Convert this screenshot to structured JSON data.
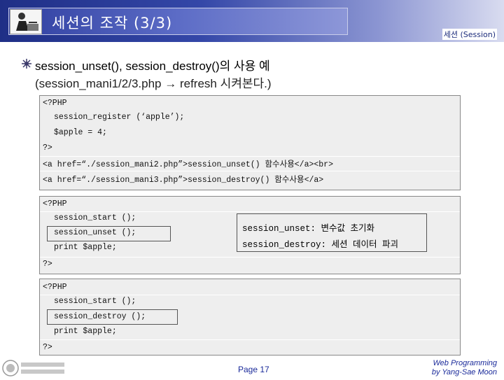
{
  "header": {
    "title": "세션의 조작 (3/3)",
    "corner_tag": "세션 (Session)"
  },
  "main": {
    "heading_line1": "session_unset(), session_destroy()의 사용 예",
    "heading_line2": "(session_mani1/2/3.php → refresh 시켜본다.)"
  },
  "code_block1": {
    "lines": [
      "<?PHP",
      "session_register (‘apple’);",
      "$apple = 4;",
      "?>",
      "<a href=“./session_mani2.php”>session_unset() 함수사용</a><br>",
      "<a href=“./session_mani3.php”>session_destroy() 함수사용</a>"
    ]
  },
  "code_block2": {
    "lines": [
      "<?PHP",
      "session_start ();",
      "session_unset ();",
      "print $apple;",
      "?>"
    ]
  },
  "code_block3": {
    "lines": [
      "<?PHP",
      "session_start ();",
      "session_destroy ();",
      "print $apple;",
      "?>"
    ]
  },
  "side_note": {
    "line1": "session_unset: 변수값 초기화",
    "line2": "session_destroy: 세션 데이터 파괴"
  },
  "footer": {
    "page": "Page 17",
    "credit_line1": "Web Programming",
    "credit_line2": "by Yang-Sae Moon"
  },
  "colors": {
    "header_dark": "#1f2f86",
    "accent_text": "#1a2a9a",
    "code_bg": "#eeeeee"
  }
}
